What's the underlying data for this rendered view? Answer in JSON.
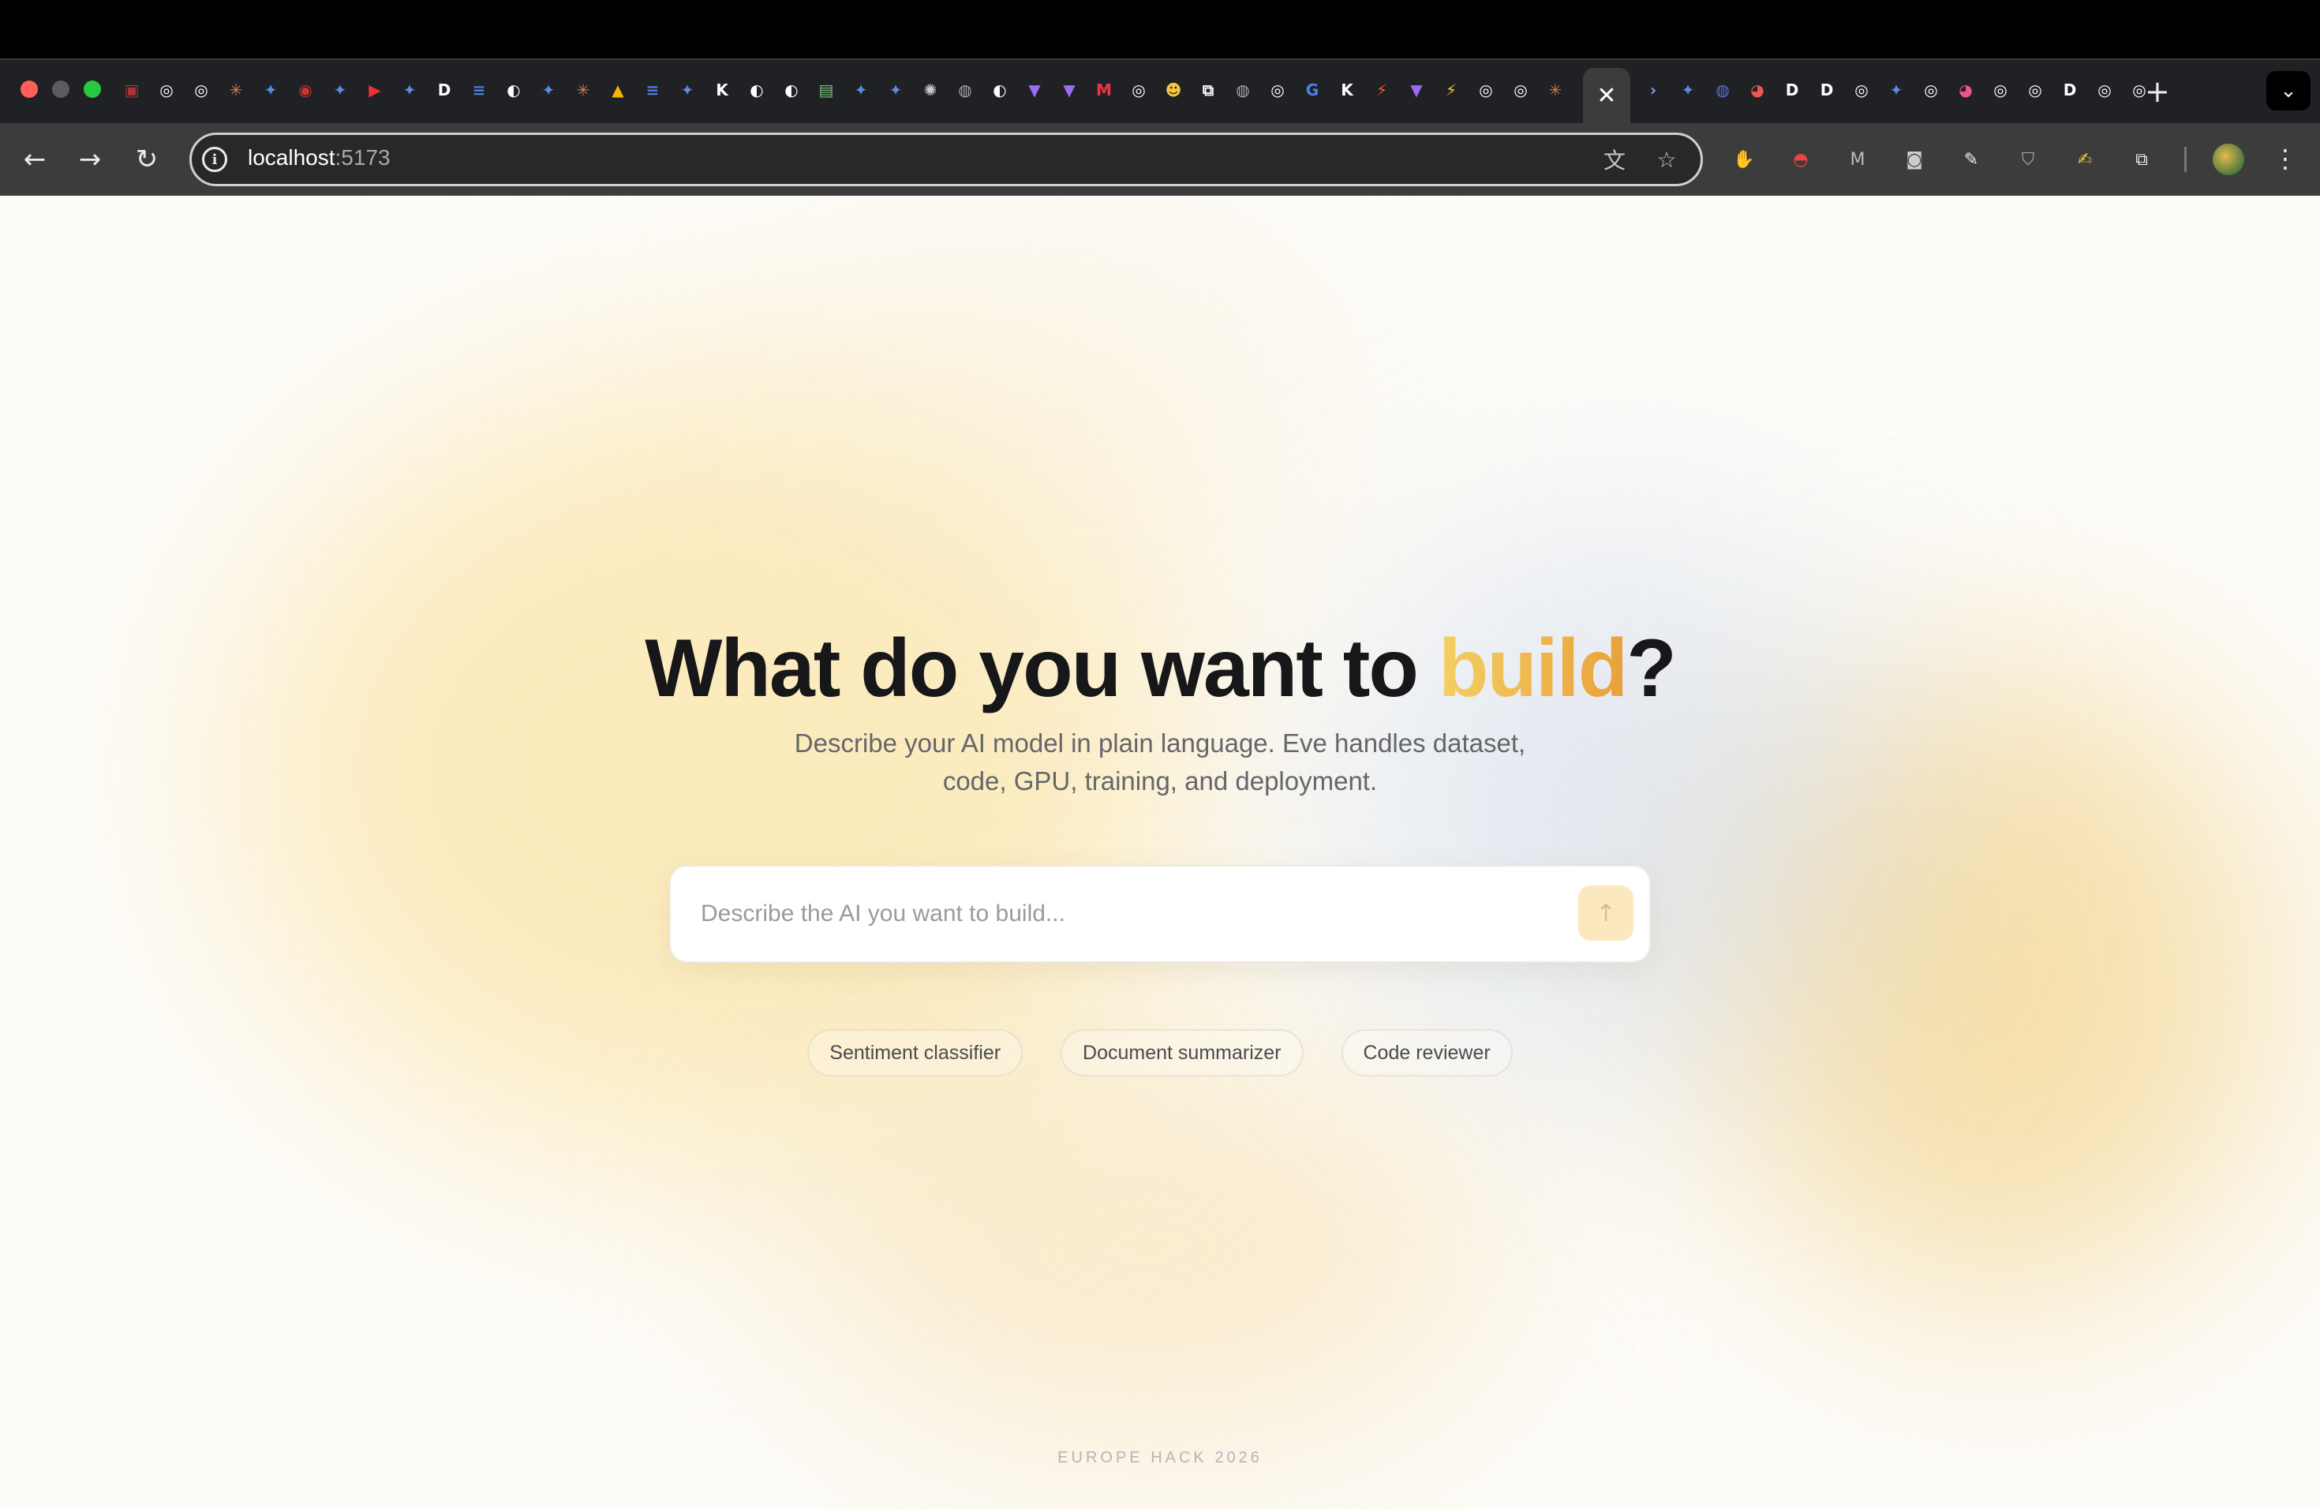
{
  "browser": {
    "address": {
      "host": "localhost",
      "port": ":5173"
    },
    "active_tab_close": "✕",
    "new_tab": "+",
    "tab_menu": "⌄",
    "back": "←",
    "forward": "→",
    "reload": "↻",
    "menu": "⋮",
    "tab_favicons_left": [
      {
        "glyph": "▣",
        "color": "#a33"
      },
      {
        "glyph": "◎",
        "color": "#fff"
      },
      {
        "glyph": "◎",
        "color": "#fff"
      },
      {
        "glyph": "✳",
        "color": "#d97757"
      },
      {
        "glyph": "✦",
        "color": "#5a8be6"
      },
      {
        "glyph": "◉",
        "color": "#c33"
      },
      {
        "glyph": "✦",
        "color": "#5a8be6"
      },
      {
        "glyph": "▶",
        "color": "#e33"
      },
      {
        "glyph": "✦",
        "color": "#5a8be6"
      },
      {
        "glyph": "D",
        "color": "#fff"
      },
      {
        "glyph": "≡",
        "color": "#4a80e8"
      },
      {
        "glyph": "◐",
        "color": "#fff"
      },
      {
        "glyph": "✦",
        "color": "#5a8be6"
      },
      {
        "glyph": "✳",
        "color": "#d97757"
      },
      {
        "glyph": "▲",
        "color": "#f5b400"
      },
      {
        "glyph": "≡",
        "color": "#4a80e8"
      },
      {
        "glyph": "✦",
        "color": "#5a8be6"
      },
      {
        "glyph": "K",
        "color": "#fff"
      },
      {
        "glyph": "◐",
        "color": "#fff"
      },
      {
        "glyph": "◐",
        "color": "#fff"
      },
      {
        "glyph": "▤",
        "color": "#7bc47f"
      },
      {
        "glyph": "✦",
        "color": "#5a8be6"
      },
      {
        "glyph": "✦",
        "color": "#5a8be6"
      },
      {
        "glyph": "✺",
        "color": "#ccc"
      },
      {
        "glyph": "◍",
        "color": "#aaa"
      },
      {
        "glyph": "◐",
        "color": "#fff"
      },
      {
        "glyph": "▼",
        "color": "#9b6cf0"
      },
      {
        "glyph": "▼",
        "color": "#9b6cf0"
      },
      {
        "glyph": "M",
        "color": "#e34"
      },
      {
        "glyph": "◎",
        "color": "#fff"
      },
      {
        "glyph": "☻",
        "color": "#f5c542"
      },
      {
        "glyph": "⧉",
        "color": "#fff"
      },
      {
        "glyph": "◍",
        "color": "#aaa"
      },
      {
        "glyph": "◎",
        "color": "#fff"
      },
      {
        "glyph": "G",
        "color": "#4a80e8"
      },
      {
        "glyph": "K",
        "color": "#fff"
      },
      {
        "glyph": "⚡",
        "color": "#ff5722"
      },
      {
        "glyph": "▼",
        "color": "#9b6cf0"
      },
      {
        "glyph": "⚡",
        "color": "#f5c542"
      },
      {
        "glyph": "◎",
        "color": "#fff"
      },
      {
        "glyph": "◎",
        "color": "#fff"
      },
      {
        "glyph": "✳",
        "color": "#d97757"
      }
    ],
    "tab_favicons_right": [
      {
        "glyph": "›",
        "color": "#7aa2ff"
      },
      {
        "glyph": "✦",
        "color": "#5a8be6"
      },
      {
        "glyph": "◍",
        "color": "#5a6ee6"
      },
      {
        "glyph": "◕",
        "color": "#e55"
      },
      {
        "glyph": "D",
        "color": "#fff"
      },
      {
        "glyph": "D",
        "color": "#fff"
      },
      {
        "glyph": "◎",
        "color": "#fff"
      },
      {
        "glyph": "✦",
        "color": "#5a8be6"
      },
      {
        "glyph": "◎",
        "color": "#fff"
      },
      {
        "glyph": "◕",
        "color": "#e58"
      },
      {
        "glyph": "◎",
        "color": "#fff"
      },
      {
        "glyph": "◎",
        "color": "#fff"
      },
      {
        "glyph": "D",
        "color": "#fff"
      },
      {
        "glyph": "◎",
        "color": "#fff"
      },
      {
        "glyph": "◎",
        "color": "#fff"
      }
    ],
    "extensions": [
      {
        "name": "hand-extension-icon",
        "glyph": "✋",
        "color": "#e33"
      },
      {
        "name": "pokeball-extension-icon",
        "glyph": "◓",
        "color": "#e44"
      },
      {
        "name": "m-extension-icon",
        "glyph": "M",
        "color": "#bbb"
      },
      {
        "name": "camera-extension-icon",
        "glyph": "◙",
        "color": "#ccc"
      },
      {
        "name": "eyedropper-extension-icon",
        "glyph": "✎",
        "color": "#eee"
      },
      {
        "name": "shield-extension-icon",
        "glyph": "⛉",
        "color": "#aab"
      },
      {
        "name": "note-extension-icon",
        "glyph": "✍",
        "color": "#f5c542"
      },
      {
        "name": "puzzle-extension-icon",
        "glyph": "⧉",
        "color": "#eee"
      }
    ]
  },
  "hero": {
    "title_prefix": "What do you want to ",
    "title_accent": "build",
    "title_suffix": "?",
    "subtitle": "Describe your AI model in plain language. Eve handles dataset, code, GPU, training, and deployment."
  },
  "prompt": {
    "placeholder": "Describe the AI you want to build...",
    "value": "",
    "send_icon": "↑"
  },
  "suggestions": [
    "Sentiment classifier",
    "Document summarizer",
    "Code reviewer"
  ],
  "footer": {
    "note": "EUROPE HACK 2026"
  },
  "colors": {
    "accent_start": "#f4cf63",
    "accent_end": "#e9a13a",
    "send_button_bg": "#fbe8bf"
  }
}
